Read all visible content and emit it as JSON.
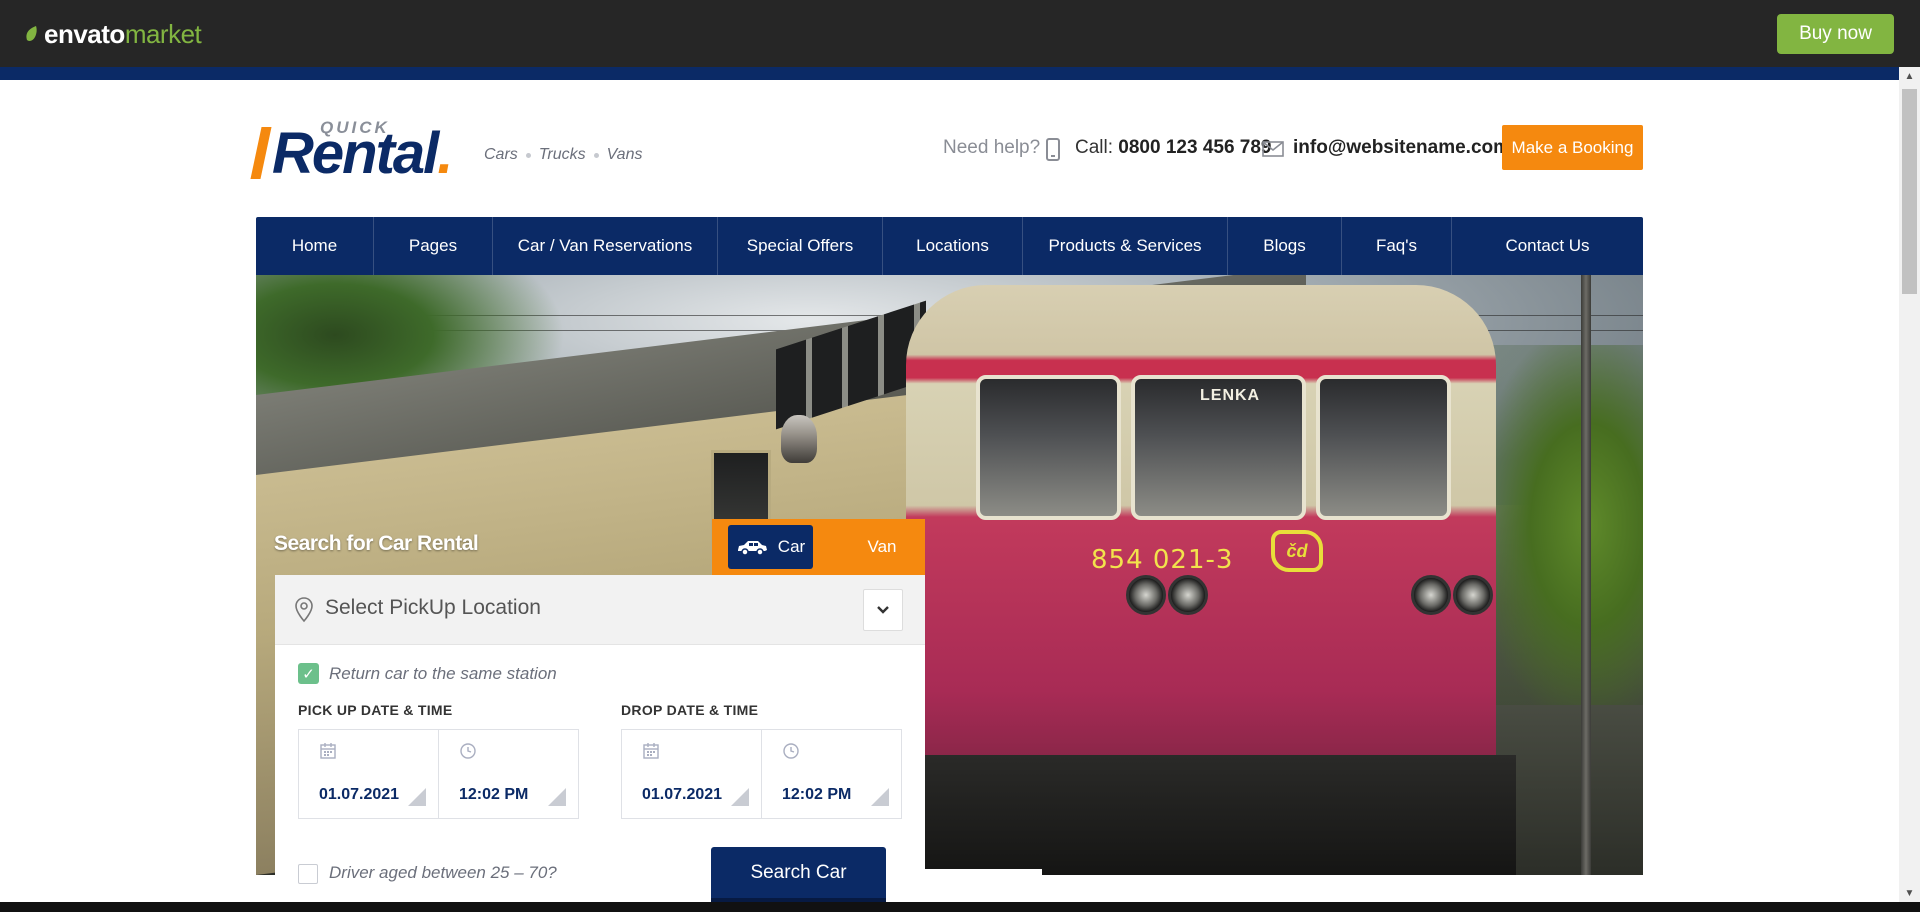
{
  "envato": {
    "logo_word1": "envato",
    "logo_word2": "market",
    "buy_now": "Buy now",
    "accent": "#82b541"
  },
  "header": {
    "logo_small": "QUICK",
    "logo_main": "Rental",
    "tagline": [
      "Cars",
      "Trucks",
      "Vans"
    ],
    "need_help": "Need help?",
    "call_prefix": "Call:",
    "phone": "0800 123 456 789",
    "email": "info@websitename.com",
    "booking_button": "Make a Booking"
  },
  "nav": {
    "items": [
      {
        "label": "Home"
      },
      {
        "label": "Pages"
      },
      {
        "label": "Car / Van Reservations"
      },
      {
        "label": "Special Offers"
      },
      {
        "label": "Locations"
      },
      {
        "label": "Products & Services"
      },
      {
        "label": "Blogs"
      },
      {
        "label": "Faq's"
      },
      {
        "label": "Contact Us"
      }
    ]
  },
  "hero": {
    "train_nameplate": "LENKA",
    "train_number": "854 021-3",
    "operator_mark": "čd"
  },
  "search": {
    "title": "Search for Car Rental",
    "tabs": {
      "car": "Car",
      "van": "Van",
      "active": "car"
    },
    "pickup_placeholder": "Select PickUp Location",
    "return_same": "Return car to the same station",
    "return_same_checked": true,
    "pickup_label": "PICK UP DATE & TIME",
    "drop_label": "DROP DATE & TIME",
    "pickup_date": "01.07.2021",
    "pickup_time": "12:02 PM",
    "drop_date": "01.07.2021",
    "drop_time": "12:02 PM",
    "driver_age": "Driver aged between 25 – 70?",
    "driver_age_checked": false,
    "search_button": "Search Car"
  },
  "colors": {
    "brand_blue": "#0b2a66",
    "brand_orange": "#f5890f",
    "check_green": "#6cc08b"
  }
}
